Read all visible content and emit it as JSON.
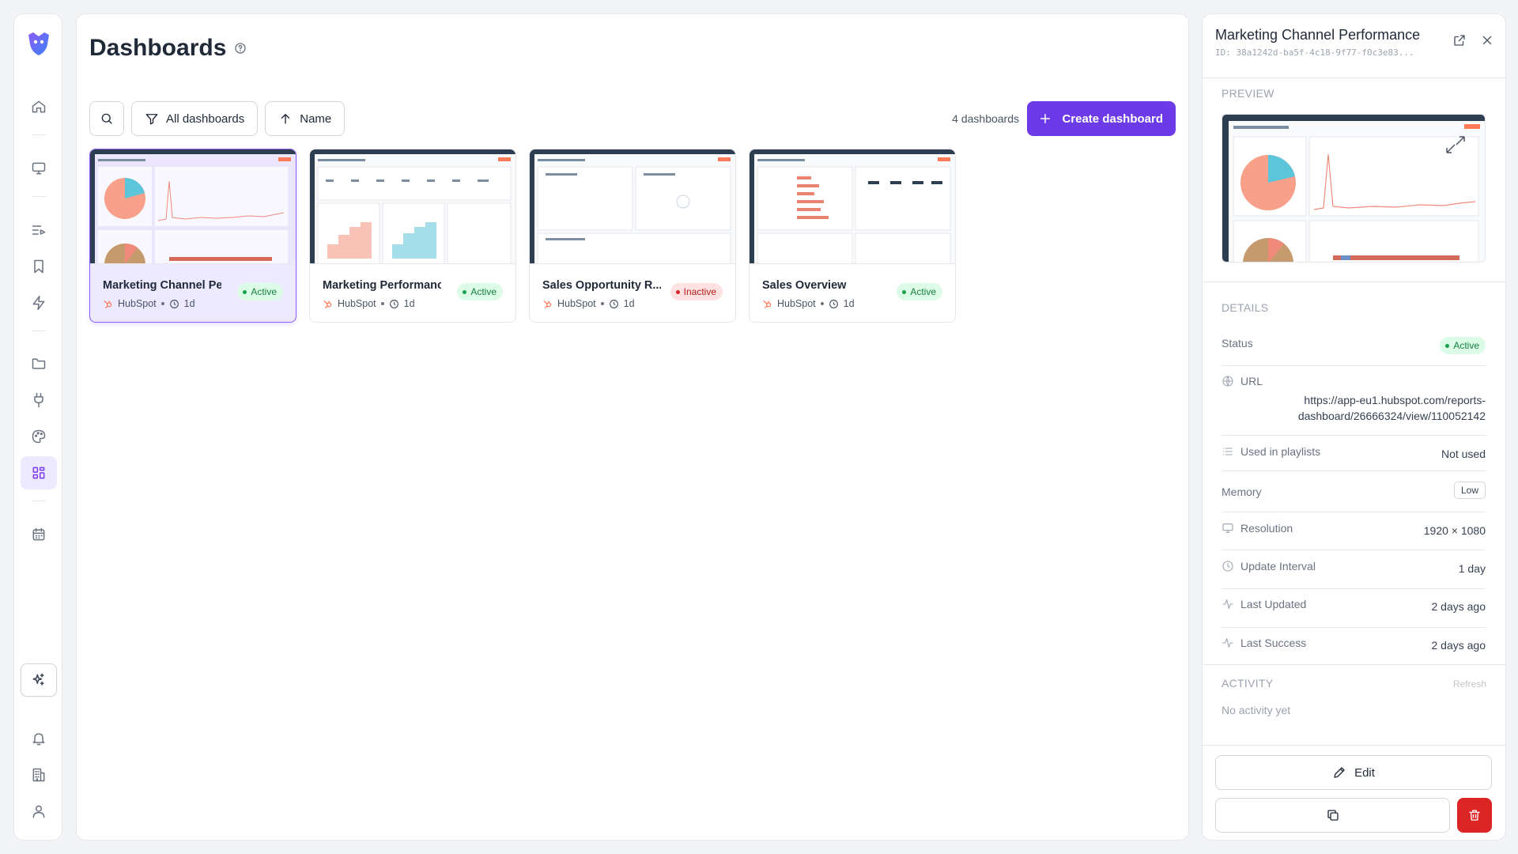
{
  "app": {
    "accent_color": "#6d3ae8",
    "rail_icons": [
      "home-icon",
      "monitor-icon",
      "playlist-icon",
      "bookmark-icon",
      "bolt-icon",
      "folder-icon",
      "plug-icon",
      "palette-icon",
      "dashboard-grid-icon",
      "calendar-icon",
      "sparkles-icon",
      "bell-icon",
      "building-icon",
      "user-icon"
    ],
    "active_rail_item": "dashboard-grid-icon"
  },
  "header": {
    "title": "Dashboards"
  },
  "toolbar": {
    "filter_label": "All dashboards",
    "sort_label": "Name",
    "count_label": "4 dashboards",
    "create_label": "Create dashboard"
  },
  "cards": [
    {
      "name": "Marketing Channel Pe...",
      "source": "HubSpot",
      "age": "1d",
      "status": "Active",
      "selected": true
    },
    {
      "name": "Marketing Performanc...",
      "source": "HubSpot",
      "age": "1d",
      "status": "Active",
      "selected": false
    },
    {
      "name": "Sales Opportunity R...",
      "source": "HubSpot",
      "age": "1d",
      "status": "Inactive",
      "selected": false
    },
    {
      "name": "Sales Overview",
      "source": "HubSpot",
      "age": "1d",
      "status": "Active",
      "selected": false
    }
  ],
  "detail": {
    "title": "Marketing Channel Performance",
    "id_text": "ID: 38a1242d-ba5f-4c18-9f77-f0c3e83...",
    "preview_heading": "PREVIEW",
    "details_heading": "DETAILS",
    "status_label": "Status",
    "status_value": "Active",
    "url_label": "URL",
    "url_line1": "https://app-eu1.hubspot.com/reports-",
    "url_line2": "dashboard/26666324/view/110052142",
    "playlists_label": "Used in playlists",
    "playlists_value": "Not used",
    "memory_label": "Memory",
    "memory_value": "Low",
    "resolution_label": "Resolution",
    "resolution_value": "1920 × 1080",
    "interval_label": "Update Interval",
    "interval_value": "1 day",
    "updated_label": "Last Updated",
    "updated_value": "2 days ago",
    "success_label": "Last Success",
    "success_value": "2 days ago",
    "activity_heading": "ACTIVITY",
    "refresh_label": "Refresh",
    "no_activity": "No activity yet",
    "edit_label": "Edit"
  }
}
